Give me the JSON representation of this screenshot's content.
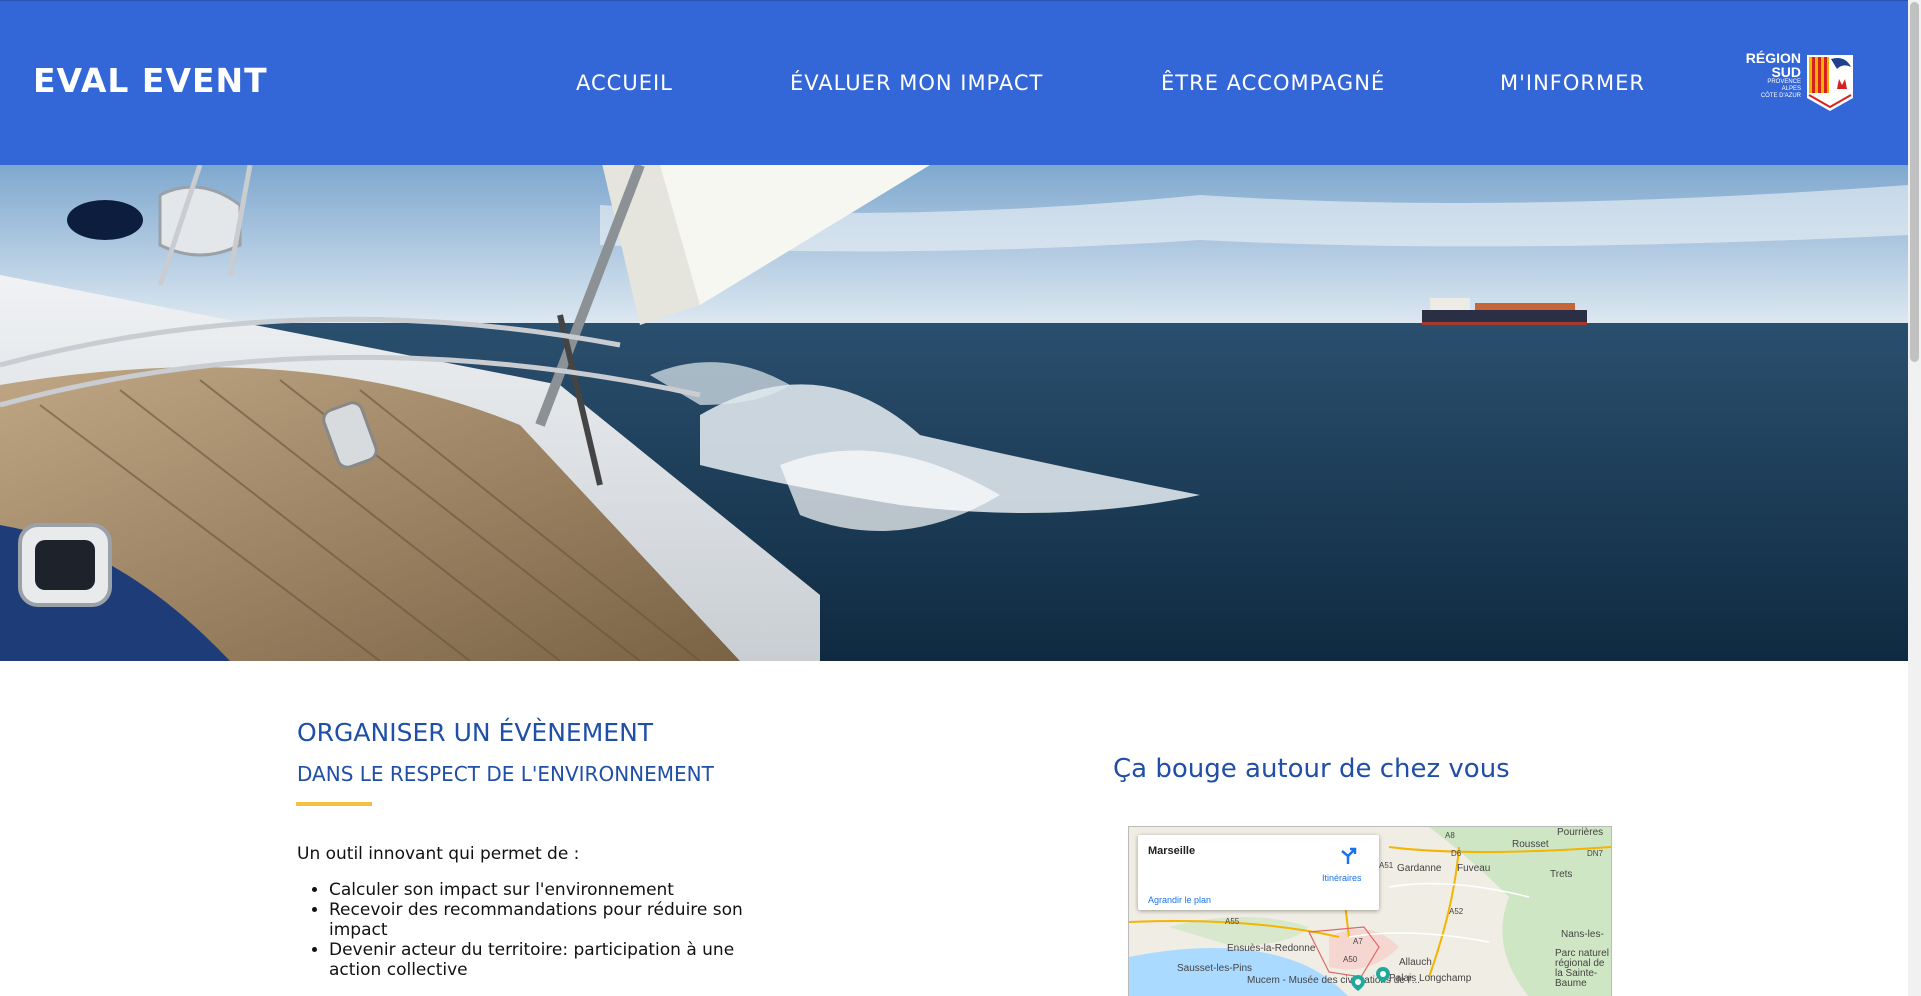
{
  "header": {
    "brand": "EVAL EVENT",
    "nav": [
      "ACCUEIL",
      "ÉVALUER MON IMPACT",
      "ÊTRE ACCOMPAGNÉ",
      "M'INFORMER"
    ],
    "logo": {
      "line1": "RÉGION",
      "line2": "SUD",
      "line3": "PROVENCE",
      "line4": "ALPES",
      "line5": "CÔTE D'AZUR"
    }
  },
  "colors": {
    "header_bg": "#3366d6",
    "title": "#1f4fa6",
    "accent": "#f5c042"
  },
  "hero": {
    "image": "sailboat-at-sea-with-cargo-ship-photo"
  },
  "intro_section": {
    "title": "ORGANISER UN ÉVÈNEMENT",
    "subtitle": "DANS LE RESPECT DE L'ENVIRONNEMENT",
    "lead": "Un outil innovant qui permet de :",
    "bullets": [
      "Calculer son impact sur l'environnement",
      "Recevoir des recommandations pour réduire son impact",
      "Devenir acteur du territoire: participation à une action collective"
    ]
  },
  "map_section": {
    "title": "Ça bouge autour de chez vous",
    "map": {
      "place": "Marseille",
      "directions": "Itinéraires",
      "enlarge": "Agrandir le plan",
      "labels": [
        "Rousset",
        "Gardanne",
        "Fuveau",
        "Trets",
        "Ensuès-la-Redonne",
        "Sausset-les-Pins",
        "Allauch",
        "Mucem - Musée des civilisations de l'...",
        "Palais Longchamp",
        "Parc naturel régional de la Sainte-Baume",
        "Nans-les-",
        "Pourrières",
        "A8",
        "A52",
        "A55",
        "A51",
        "A7",
        "A50",
        "D6",
        "DN7"
      ]
    }
  }
}
